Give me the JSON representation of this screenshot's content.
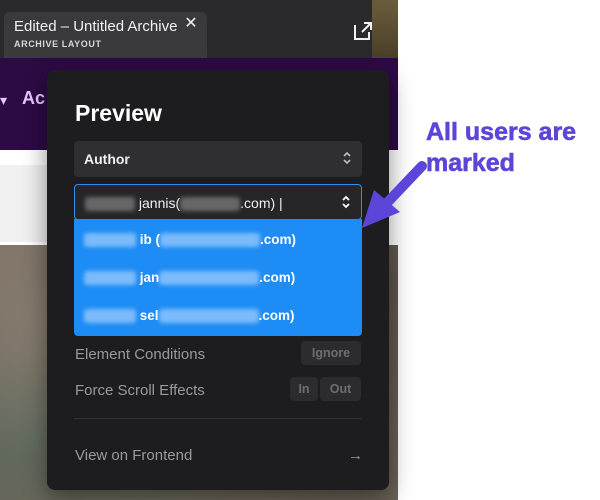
{
  "tab": {
    "title": "Edited – Untitled Archive",
    "subtitle": "ARCHIVE LAYOUT",
    "close_glyph": "✕"
  },
  "icons": {
    "external": "external-link-icon",
    "close": "close-icon",
    "updown": "chevron-up-down-icon",
    "arrow_right": "arrow-right-icon"
  },
  "background": {
    "heading_fragment": "Ac",
    "chevron": "▾"
  },
  "preview": {
    "title": "Preview",
    "author_select": {
      "value": "Author"
    },
    "user_select": {
      "value_visible": "jannis(",
      "value_suffix": ".com)",
      "caret": "|"
    },
    "options": [
      {
        "prefix": "ib (",
        "suffix": ".com)"
      },
      {
        "prefix": "jan",
        "suffix": ".com)"
      },
      {
        "prefix": "sel",
        "suffix": ".com)"
      }
    ],
    "element_conditions": {
      "label": "Element Conditions",
      "button": "Ignore"
    },
    "force_scroll": {
      "label": "Force Scroll Effects",
      "in": "In",
      "out": "Out"
    },
    "frontend": {
      "label": "View on Frontend",
      "arrow": "→"
    }
  },
  "annotation": {
    "line1": "All users are",
    "line2": "marked",
    "color": "#5b46d9"
  },
  "colors": {
    "accent": "#1e8cf5",
    "panel": "#1d1d1f",
    "purple_band": "#2d0a45"
  }
}
